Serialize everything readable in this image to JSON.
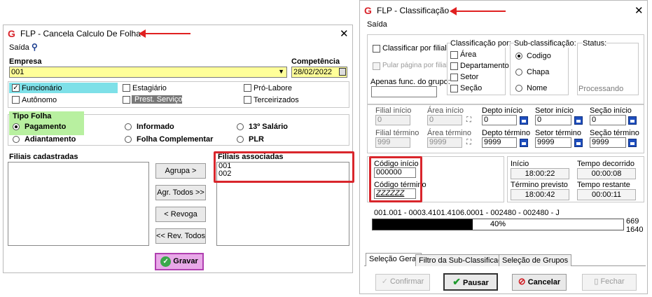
{
  "left_window": {
    "title": "FLP - Cancela Calculo De Folha",
    "menu_saida": "Saída",
    "empresa_label": "Empresa",
    "empresa_value": "001",
    "competencia_label": "Competência",
    "competencia_value": "28/02/2022",
    "checks": {
      "funcionario": "Funcionário",
      "autonomo": "Autônomo",
      "estagiario": "Estagiário",
      "prest_servicos": "Prest. Serviços",
      "pro_labore": "Pró-Labore",
      "terceirizados": "Terceirizados"
    },
    "tipo_folha_label": "Tipo Folha",
    "radios": {
      "pagamento": "Pagamento",
      "adiantamento": "Adiantamento",
      "informado": "Informado",
      "folha_complementar": "Folha Complementar",
      "decimo_terceiro": "13º Salário",
      "plr": "PLR"
    },
    "filiais_cadastradas_label": "Filiais cadastradas",
    "filiais_associadas_label": "Filiais associadas",
    "filiais_associadas": [
      "001",
      "002"
    ],
    "buttons": {
      "agrupa": "Agrupa >",
      "agr_todos": "Agr. Todos >>",
      "revoga": "< Revoga",
      "rev_todos": "<< Rev. Todos",
      "gravar": "Gravar"
    }
  },
  "right_window": {
    "title": "FLP - Classificação",
    "menu_saida": "Saída",
    "classificar_por_filial": "Classificar por filial",
    "pular_pagina": "Pular página por filial",
    "apenas_func_label": "Apenas func. do grupo:",
    "classificacao_por_label": "Classificação por:",
    "classificacao_options": [
      "Área",
      "Departamento",
      "Setor",
      "Seção"
    ],
    "sub_classificacao_label": "Sub-classificação:",
    "sub_options": [
      "Codigo",
      "Chapa",
      "Nome"
    ],
    "status_label": "Status:",
    "status_value": "Processando",
    "ranges": {
      "filial_inicio_label": "Filial início",
      "filial_inicio": "0",
      "filial_termino_label": "Filial término",
      "filial_termino": "999",
      "area_inicio_label": "Área início",
      "area_inicio": "0",
      "area_termino_label": "Área término",
      "area_termino": "9999",
      "depto_inicio_label": "Depto início",
      "depto_inicio": "0",
      "depto_termino_label": "Depto término",
      "depto_termino": "9999",
      "setor_inicio_label": "Setor início",
      "setor_inicio": "0",
      "setor_termino_label": "Setor término",
      "setor_termino": "9999",
      "secao_inicio_label": "Seção início",
      "secao_inicio": "0",
      "secao_termino_label": "Seção término",
      "secao_termino": "9999"
    },
    "codigo_inicio_label": "Código início",
    "codigo_inicio": "000000",
    "codigo_termino_label": "Código término",
    "codigo_termino": "ZZZZZZ",
    "times": {
      "inicio_label": "Início",
      "inicio": "18:00:22",
      "tempo_decorrido_label": "Tempo decorrido",
      "tempo_decorrido": "00:00:08",
      "termino_previsto_label": "Término previsto",
      "termino_previsto": "18:00:42",
      "tempo_restante_label": "Tempo restante",
      "tempo_restante": "00:00:11"
    },
    "progress_text": "001.001 - 0003.4101.4106.0001 - 002480 - 002480 - J",
    "progress_percent": 40,
    "progress_label": "40%",
    "count_total": "669",
    "count_current": "1640",
    "tabs": [
      "Seleção Geral",
      "Filtro da Sub-Classificação",
      "Seleção de Grupos"
    ],
    "buttons": {
      "confirmar": "Confirmar",
      "pausar": "Pausar",
      "cancelar": "Cancelar",
      "fechar": "Fechar"
    }
  }
}
